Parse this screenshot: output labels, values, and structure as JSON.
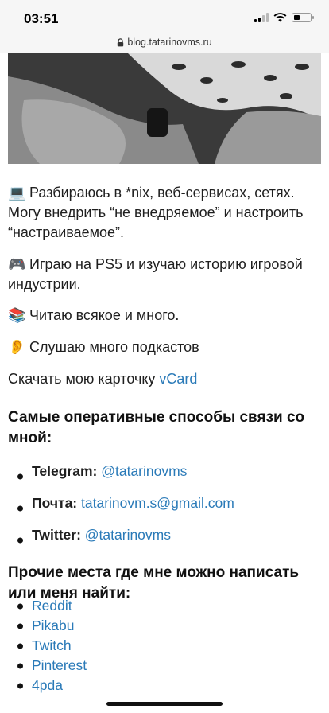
{
  "status": {
    "time": "03:51"
  },
  "browser": {
    "url": "blog.tatarinovms.ru"
  },
  "about": [
    {
      "icon": "💻",
      "icon_name": "laptop-icon",
      "text": "Разбираюсь в *nix, веб-сервисах, сетях. Могу внедрить “не внедряемое” и настроить “настраиваемое”."
    },
    {
      "icon": "🎮",
      "icon_name": "gamepad-icon",
      "text": "Играю на PS5 и изучаю историю игровой индустрии."
    },
    {
      "icon": "📚",
      "icon_name": "books-icon",
      "text": "Читаю всякое и много."
    },
    {
      "icon": "👂",
      "icon_name": "ear-icon",
      "text": "Слушаю много подкастов"
    }
  ],
  "vcard": {
    "text": "Скачать мою карточку ",
    "link": "vCard"
  },
  "contacts": {
    "heading": "Самые оперативные способы связи со мной:",
    "items": [
      {
        "label": "Telegram:",
        "value": "@tatarinovms"
      },
      {
        "label": "Почта:",
        "value": "tatarinovm.s@gmail.com"
      },
      {
        "label": "Twitter:",
        "value": "@tatarinovms"
      }
    ]
  },
  "other": {
    "heading": "Прочие места где мне можно написать или меня найти:",
    "links": [
      "Reddit",
      "Pikabu",
      "Twitch",
      "Pinterest",
      "4pda"
    ]
  },
  "colors": {
    "link": "#2a7ab8",
    "text": "#1f1f1f",
    "chrome": "#f6f6f6"
  }
}
